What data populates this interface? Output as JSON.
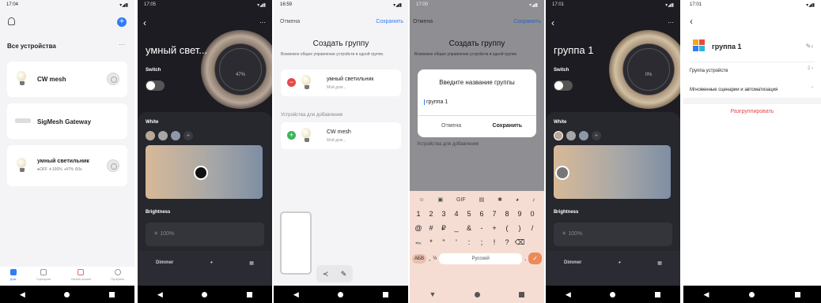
{
  "p1": {
    "time": "17:04",
    "status": "▾◢▮",
    "section": "Все устройства",
    "more": "···",
    "devices": [
      {
        "name": "CW mesh"
      },
      {
        "name": "SigMesh Gateway"
      },
      {
        "name": "умный светильник",
        "status": "●OFF ☀100% ◑47% ⏱0s"
      }
    ],
    "tabs": [
      "Дом",
      "Сценарии",
      "Умный режим",
      "Профиль"
    ]
  },
  "p2": {
    "time": "17:05",
    "title": "умный свет...",
    "switch": "Switch",
    "percent": "47%",
    "white": "White",
    "brightness": "Brightness",
    "bright_val": "100%",
    "dimmer": "Dimmer",
    "more": "···"
  },
  "p3": {
    "time": "16:59",
    "cancel": "Отмена",
    "save": "Сохранить",
    "title": "Создать группу",
    "info": "Возможно общее управление устройств в одной группе.",
    "dev1": "умный светильник",
    "dev1_sub": "Мой дом...",
    "section": "Устройства для добавления",
    "dev2": "CW mesh",
    "dev2_sub": "Мой дом..."
  },
  "p4": {
    "time": "17:00",
    "cancel": "Отмена",
    "save": "Сохранить",
    "title": "Создать группу",
    "info": "Возможно общее управление устройств в одной группе.",
    "dialog_title": "Введите название группы",
    "input": "группа 1",
    "d_cancel": "Отмена",
    "d_save": "Сохранить",
    "section": "Устройства для добавления",
    "row1": [
      "1",
      "2",
      "3",
      "4",
      "5",
      "6",
      "7",
      "8",
      "9",
      "0"
    ],
    "row2": [
      "@",
      "#",
      "₽",
      "_",
      "&",
      "-",
      "+",
      "(",
      ")",
      "/"
    ],
    "row3": [
      "=\\<",
      "*",
      "\"",
      "'",
      ":",
      ";",
      "!",
      "?",
      "⌫"
    ],
    "abc": "АБВ",
    "lang": "Русский",
    "gif": "GIF"
  },
  "p5": {
    "time": "17:01",
    "title": "группа 1",
    "switch": "Switch",
    "percent": "0%",
    "white": "White",
    "brightness": "Brightness",
    "bright_val": "100%",
    "dimmer": "Dimmer",
    "more": "···"
  },
  "p6": {
    "time": "17:01",
    "group_name": "группа 1",
    "r1": "Группа устройств",
    "r1_val": "2 ›",
    "r2": "Мгновенные сценарии и автоматизация",
    "r2_arrow": "›",
    "ungroup": "Разгруппировать"
  }
}
